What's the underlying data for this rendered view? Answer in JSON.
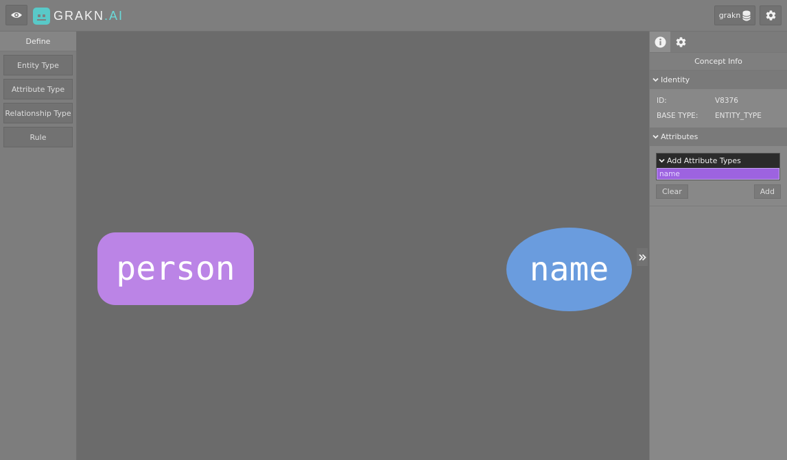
{
  "header": {
    "logo_main": "GRAKN",
    "logo_dot": ".",
    "logo_suffix": "AI",
    "keyspace_label": "grakn",
    "icons": {
      "view": "eye-icon",
      "keyspace": "database-icon",
      "settings": "gear-icon"
    }
  },
  "define_panel": {
    "title": "Define",
    "buttons": [
      "Entity Type",
      "Attribute Type",
      "Relationship Type",
      "Rule"
    ]
  },
  "graph": {
    "nodes": [
      {
        "label": "person",
        "kind": "entity",
        "color": "#bb84e6"
      },
      {
        "label": "name",
        "kind": "attribute",
        "color": "#6a9cde"
      }
    ],
    "collapse_icon": "double-chevron-right-icon"
  },
  "right_panel": {
    "tabs": [
      {
        "icon": "info-icon"
      },
      {
        "icon": "gear-icon"
      }
    ],
    "title": "Concept Info",
    "identity": {
      "header": "Identity",
      "id_label": "ID:",
      "id_value": "V8376",
      "base_type_label": "BASE TYPE:",
      "base_type_value": "ENTITY_TYPE"
    },
    "attributes": {
      "header": "Attributes",
      "dropdown_label": "Add Attribute Types",
      "options": [
        "name"
      ],
      "clear_label": "Clear",
      "add_label": "Add"
    }
  },
  "colors": {
    "accent_teal": "#59c9c8",
    "selection_purple": "#9d63e0",
    "canvas_bg": "#6b6b6b"
  }
}
